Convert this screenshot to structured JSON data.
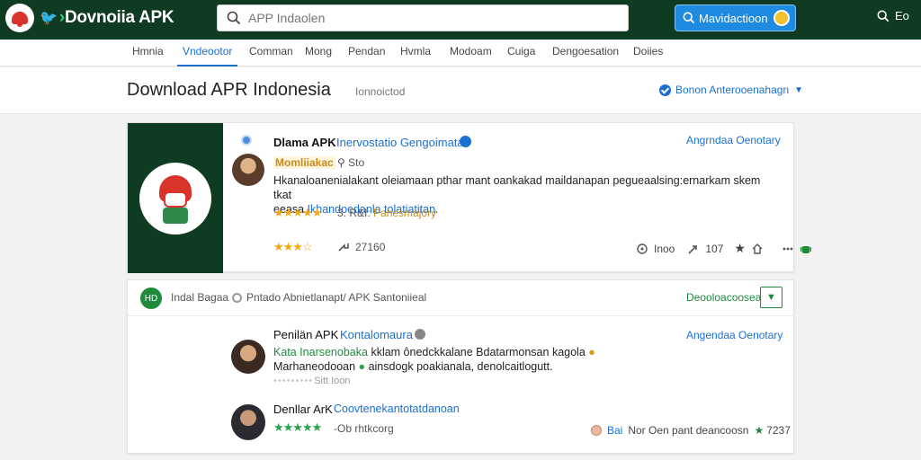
{
  "header": {
    "title_prefix": "Dovnoiia",
    "title_suffix": "APK",
    "search_placeholder": "APP Indaolen",
    "primary_button": "Mavidactioon",
    "top_search_label": "Eo"
  },
  "nav": {
    "tabs": [
      "Hmnia",
      "Vndeootor",
      "Comman",
      "Mong",
      "Pendan",
      "Hvmla",
      "Modoam",
      "Cuiga",
      "Dengoesation",
      "Doiies"
    ],
    "active": 1
  },
  "page": {
    "title": "Download APR Indonesia",
    "subtitle": "Ionnoictod",
    "sort_label": "Bonon Anterooenahagn"
  },
  "card1": {
    "title": "Dlama APK",
    "link": "Inervostatio Gengoimata",
    "right_link": "Angrndaa Oenotary",
    "tag": "Momliiakac",
    "meta": "Sto",
    "desc_main": "Hkanaloanenialakant oleiamaan pthar mant oankakad maildanapan pegueaalsing:ernarkam skem tkat",
    "desc_pre": "eeasa",
    "desc_link": "Ikhandoedanla tolatiatitan.",
    "rating_num": "3. R&I:",
    "rating_label": "Pahesmajory",
    "stars_bottom": "★★★☆",
    "downloads": "27160",
    "view_count": "Inoo",
    "share_count": "107"
  },
  "card2": {
    "badge": "HD",
    "label": "Indal Bagaa",
    "crumb": "Pntado Abnietlanapt/ APK Santoniieal",
    "action": "Deooloacoosea",
    "review1": {
      "title": "Penilän APK",
      "link": "Kontalomaura",
      "right": "Angendaa Oenotary",
      "text_green": "Kata Inarsenobaka",
      "text_1": "kklam ônedckkalane Bdatarmonsan kagola",
      "text_2": "Marhaneodooan",
      "text_3": "ainsdogk poakianala, denolcaitlogutt.",
      "meta": "Sitt Ioon"
    },
    "review2": {
      "title": "Denllar ArK",
      "link": "Coovtenekantotatdanoan",
      "meta": "-Ob rhtkcorg",
      "right_b": "Bai",
      "right_text": "Nor Oen pant deancoosn",
      "right_num": "7237"
    }
  }
}
